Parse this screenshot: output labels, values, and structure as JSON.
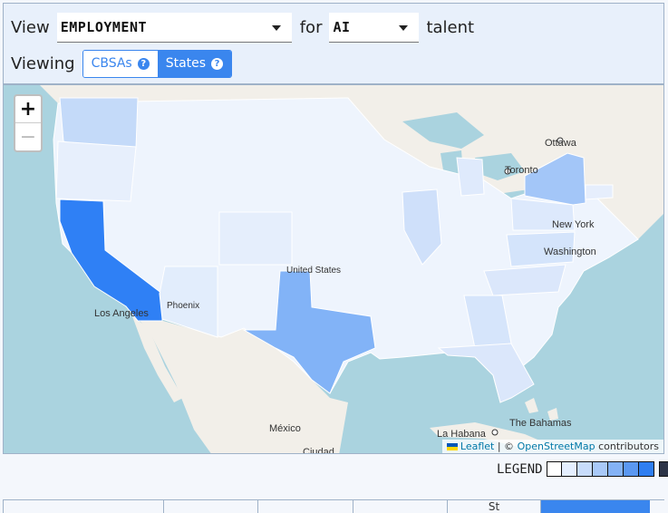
{
  "controls": {
    "view_label": "View",
    "metric_value": "EMPLOYMENT",
    "for_label": "for",
    "talent_value": "AI",
    "talent_label": "talent",
    "viewing_label": "Viewing",
    "toggle_cbsas": "CBSAs",
    "toggle_states": "States",
    "help_glyph": "?"
  },
  "map": {
    "zoom_in": "+",
    "zoom_out": "−",
    "labels": {
      "ottawa": "Ottawa",
      "toronto": "Toronto",
      "new_york": "New York",
      "washington": "Washington",
      "united_states": "United States",
      "phoenix": "Phoenix",
      "los_angeles": "Los Angeles",
      "mexico": "México",
      "ciudad": "Ciudad",
      "la_habana": "La Habana",
      "bahamas": "The Bahamas"
    },
    "attribution": {
      "leaflet": "Leaflet",
      "separator": "| ©",
      "osm": "OpenStreetMap",
      "contributors": "contributors"
    },
    "colors": {
      "california": "#2f80f5",
      "texas": "#82b3f7",
      "new_york": "#a3c6f8",
      "washington": "#c4daf9",
      "illinois": "#cfe0fa",
      "virginia": "#d4e4fb",
      "low": "#eef4fd",
      "water": "#aad3df"
    }
  },
  "legend": {
    "label": "LEGEND",
    "swatches": [
      "#ffffff",
      "#e5efff",
      "#c8dcfb",
      "#a9c9f8",
      "#84b2f5",
      "#5b98f1",
      "#2f7ef0",
      "#2c3346"
    ]
  },
  "bottom_bar": {
    "tabs": [
      "",
      "",
      "",
      "",
      "St",
      ""
    ]
  }
}
